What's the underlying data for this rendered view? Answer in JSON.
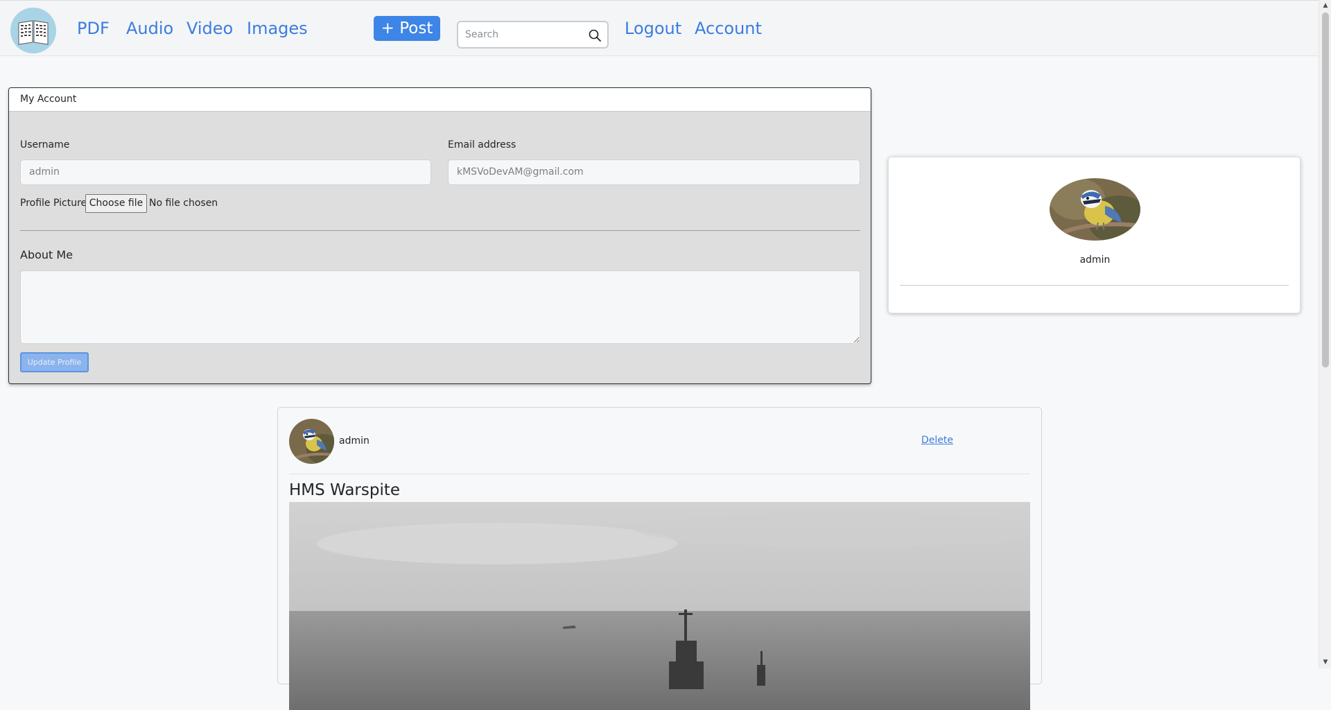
{
  "navbar": {
    "links": {
      "pdf": "PDF",
      "audio": "Audio",
      "video": "Video",
      "images": "Images",
      "logout": "Logout",
      "account": "Account"
    },
    "post_button": "+ Post",
    "search_placeholder": "Search"
  },
  "account_form": {
    "title": "My Account",
    "username_label": "Username",
    "username_value": "admin",
    "email_label": "Email address",
    "email_value": "kMSVoDevAM@gmail.com",
    "profile_picture_label": "Profile Picture",
    "choose_file_label": "Choose file",
    "no_file_text": "No file chosen",
    "about_me_label": "About Me",
    "about_me_value": "",
    "update_button": "Update Profile"
  },
  "profile_card": {
    "name": "admin"
  },
  "post": {
    "author": "admin",
    "delete_label": "Delete",
    "title": "HMS Warspite"
  },
  "colors": {
    "accent": "#3b7ddd",
    "post_button": "#3d85e6"
  }
}
